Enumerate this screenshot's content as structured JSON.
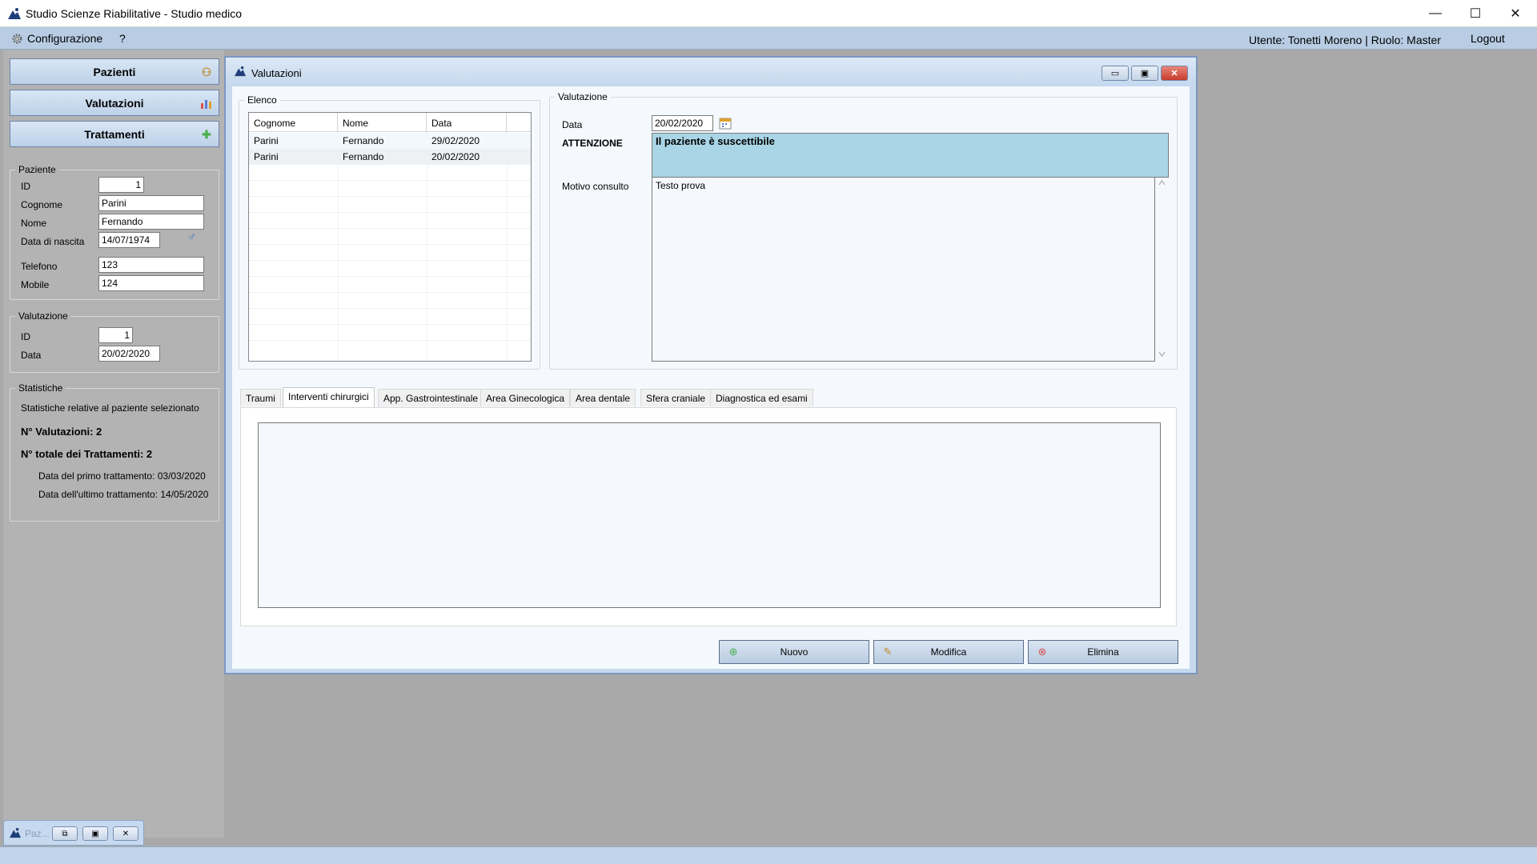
{
  "app": {
    "title": "Studio Scienze Riabilitative - Studio medico"
  },
  "window_controls": {
    "minimize": "—",
    "maximize": "☐",
    "close": "✕"
  },
  "menu": {
    "configurazione": "Configurazione",
    "help": "?",
    "user": "Utente: Tonetti Moreno | Ruolo: Master",
    "logout": "Logout"
  },
  "nav": {
    "pazienti": "Pazienti",
    "valutazioni": "Valutazioni",
    "trattamenti": "Trattamenti"
  },
  "paziente": {
    "legend": "Paziente",
    "id_label": "ID",
    "id_value": "1",
    "cognome_label": "Cognome",
    "cognome_value": "Parini",
    "nome_label": "Nome",
    "nome_value": "Fernando",
    "nascita_label": "Data di nascita",
    "nascita_value": "14/07/1974",
    "gender_icon": "♂",
    "telefono_label": "Telefono",
    "telefono_value": "123",
    "mobile_label": "Mobile",
    "mobile_value": "124"
  },
  "valutazione_side": {
    "legend": "Valutazione",
    "id_label": "ID",
    "id_value": "1",
    "data_label": "Data",
    "data_value": "20/02/2020"
  },
  "statistiche": {
    "legend": "Statistiche",
    "subtitle": "Statistiche relative al paziente selezionato",
    "n_valutazioni": "N° Valutazioni: 2",
    "n_trattamenti": "N° totale dei Trattamenti: 2",
    "primo": "Data del primo trattamento: 03/03/2020",
    "ultimo": "Data dell'ultimo trattamento: 14/05/2020"
  },
  "window": {
    "title": "Valutazioni",
    "btn_min": "▭",
    "btn_max": "▣",
    "btn_close": "✕"
  },
  "elenco": {
    "legend": "Elenco",
    "columns": [
      "Cognome",
      "Nome",
      "Data"
    ],
    "rows": [
      [
        "Parini",
        "Fernando",
        "29/02/2020"
      ],
      [
        "Parini",
        "Fernando",
        "20/02/2020"
      ]
    ]
  },
  "valutazione_form": {
    "legend": "Valutazione",
    "data_label": "Data",
    "data_value": "20/02/2020",
    "attenzione_label": "ATTENZIONE",
    "attenzione_value": "Il paziente è suscettibile",
    "motivo_label": "Motivo consulto",
    "motivo_value": "Testo prova"
  },
  "tabs": {
    "items": [
      "Traumi",
      "Interventi chirurgici",
      "App. Gastrointestinale",
      "Area Ginecologica",
      "Area dentale",
      "Sfera craniale",
      "Diagnostica ed esami"
    ],
    "active": "Interventi chirurgici"
  },
  "actions": {
    "nuovo": "Nuovo",
    "modifica": "Modifica",
    "elimina": "Elimina"
  },
  "minimized": {
    "label": "Paz..."
  },
  "colors": {
    "accent": "#b8cde3",
    "attention_bg": "#a9d5e6",
    "desktop": "#a9a9a9"
  }
}
